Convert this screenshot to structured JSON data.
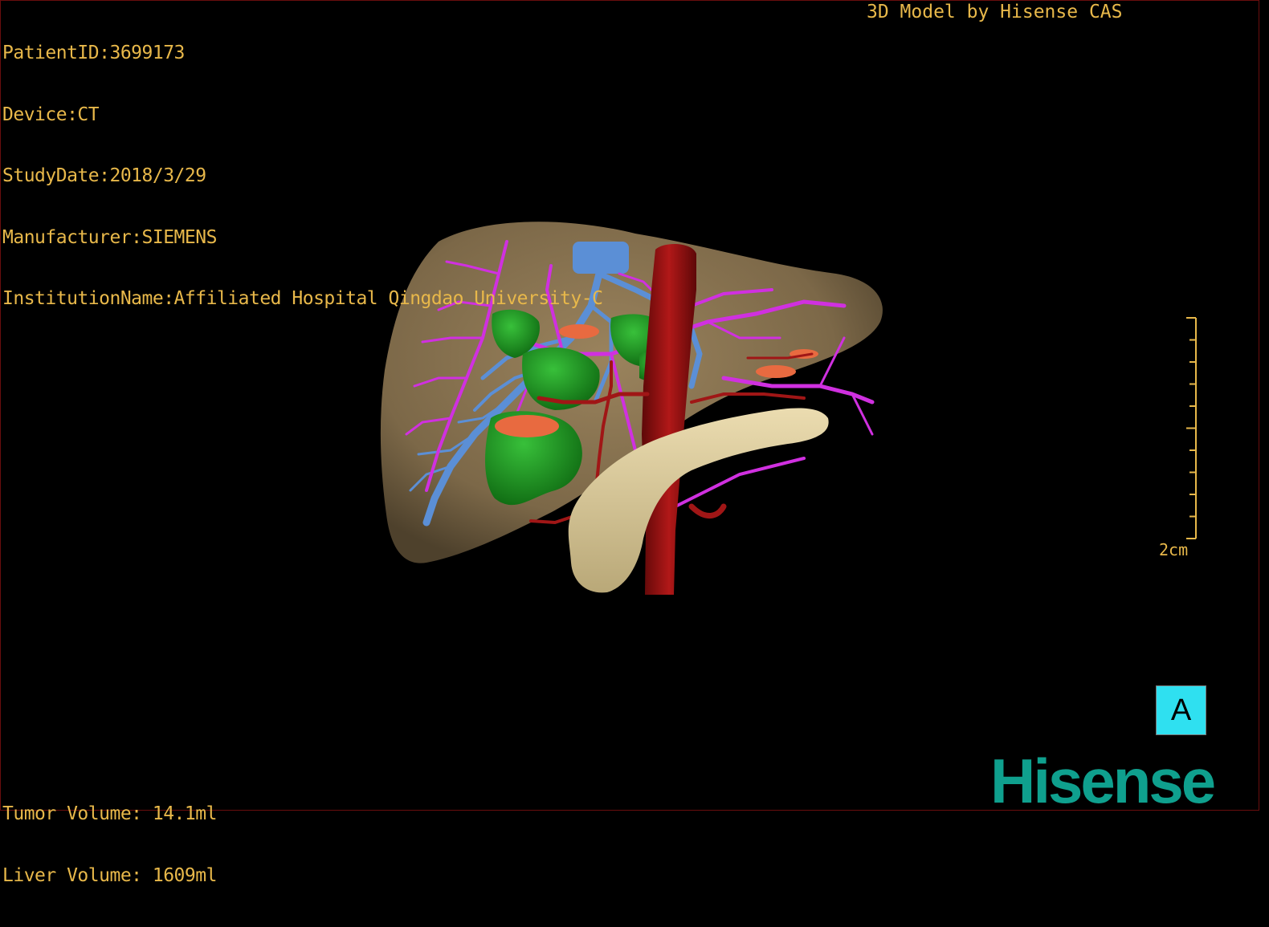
{
  "header": {
    "patient_id": "PatientID:3699173",
    "device": "Device:CT",
    "study_date": "StudyDate:2018/3/29",
    "manufacturer": "Manufacturer:SIEMENS",
    "institution": "InstitutionName:Affiliated Hospital Qingdao University-C",
    "model_credit": "3D Model by Hisense CAS"
  },
  "volumes": {
    "tumor": "Tumor Volume: 14.1ml",
    "liver": "Liver Volume: 1609ml"
  },
  "scale_bar": {
    "label": "2cm"
  },
  "orientation": {
    "label": "A"
  },
  "logo": {
    "text": "Hisense"
  },
  "colors": {
    "overlay_text": "#e8b84a",
    "liver": "#8a7350",
    "portal_vein": "#5b8fd6",
    "hepatic_vein": "#d030e0",
    "artery": "#a01616",
    "tumor": "#1fa024",
    "pancreas": "#d8c79a",
    "lesion": "#e86a40",
    "logo": "#0fa08e",
    "orientation_box": "#2fe0f0"
  }
}
